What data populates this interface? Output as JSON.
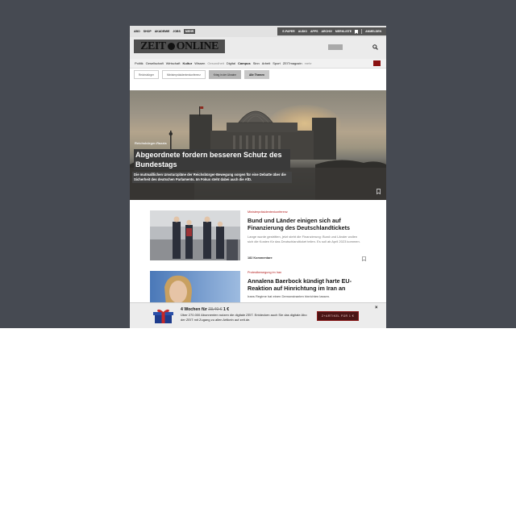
{
  "topbar": {
    "left": [
      "ABO",
      "SHOP",
      "AKADEMIE",
      "JOBS"
    ],
    "more": "MEHR",
    "right": [
      "E-PAPER",
      "AUDIO",
      "APPS",
      "ARCHIV",
      "MERKLISTE",
      "ANMELDEN"
    ]
  },
  "logo": {
    "left": "ZEIT",
    "right": "ONLINE"
  },
  "nav": {
    "items": [
      {
        "label": "Politik",
        "style": ""
      },
      {
        "label": "Gesellschaft",
        "style": ""
      },
      {
        "label": "Wirtschaft",
        "style": ""
      },
      {
        "label": "Kultur",
        "style": "bold"
      },
      {
        "label": "Wissen",
        "style": ""
      },
      {
        "label": "Gesundheit",
        "style": "muted"
      },
      {
        "label": "Digital",
        "style": ""
      },
      {
        "label": "Campus",
        "style": "bold"
      },
      {
        "label": "Sinn",
        "style": ""
      },
      {
        "label": "Arbeit",
        "style": ""
      },
      {
        "label": "Sport",
        "style": ""
      },
      {
        "label": "ZEITmagazin",
        "style": ""
      },
      {
        "label": "mehr",
        "style": "muted"
      }
    ]
  },
  "chips": [
    {
      "label": "Reichsbürger",
      "style": ""
    },
    {
      "label": "Ministerpräsidentenkonferenz",
      "style": ""
    },
    {
      "label": "Krieg in der Ukraine",
      "style": "gray"
    },
    {
      "label": "Alle Themen",
      "style": "dark"
    }
  ],
  "hero": {
    "kicker": "Reichsbürger-Razzia",
    "title": "Abgeordnete fordern besseren Schutz des Bundestags",
    "teaser": "Die mutmaßlichen Umsturzpläne der Reichsbürger-Bewegung sorgen für eine Debatte über die Sicherheit des deutschen Parlaments. Im Fokus steht dabei auch die AfD."
  },
  "articles": [
    {
      "kicker": "Ministerpräsidentenkonferenz",
      "title": "Bund und Länder einigen sich auf Finanzierung des Deutschlandtickets",
      "teaser": "Lange wurde gestritten, jetzt steht die Finanzierung: Bund und Länder wollen sich die Kosten für das Deutschlandticket teilen. Es soll ab April 2023 kommen.",
      "comments": "182 Kommentare"
    },
    {
      "kicker": "Protestbewegung im Iran",
      "title": "Annalena Baerbock kündigt harte EU-Reaktion auf Hinrichtung im Iran an",
      "teaser": "Irans Regime hat einen Demonstranten hinrichten lassen."
    }
  ],
  "promo": {
    "title": "4 Wochen für",
    "old_price": "23,40 €",
    "new_price": "1 €",
    "text": "Über 270.000 Abonnenten nutzen die digitale ZEIT. Entdecken auch Sie das digitale Abo der ZEIT mit Zugang zu allen Artikeln auf zeit.de.",
    "button": "Z+ARTIKEL FÜR 1 €",
    "close": "×"
  }
}
